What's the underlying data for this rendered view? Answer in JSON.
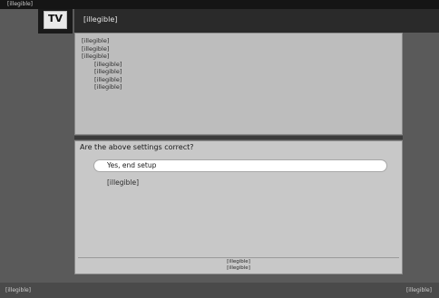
{
  "topbar": {
    "text": "[illegible]"
  },
  "logo": {
    "text": "TV"
  },
  "title": "[illegible]",
  "info": {
    "lines": [
      "[illegible]",
      "[illegible]",
      "[illegible]"
    ],
    "items": [
      "[illegible]",
      "[illegible]",
      "[illegible]",
      "[illegible]"
    ]
  },
  "question": "Are the above settings correct?",
  "options": [
    {
      "label": "Yes, end setup",
      "selected": true
    },
    {
      "label": "[illegible]",
      "selected": false
    }
  ],
  "help": {
    "lines": [
      "[illegible]",
      "[illegible]"
    ]
  },
  "status": {
    "left": "[illegible]",
    "right": "[illegible]"
  }
}
